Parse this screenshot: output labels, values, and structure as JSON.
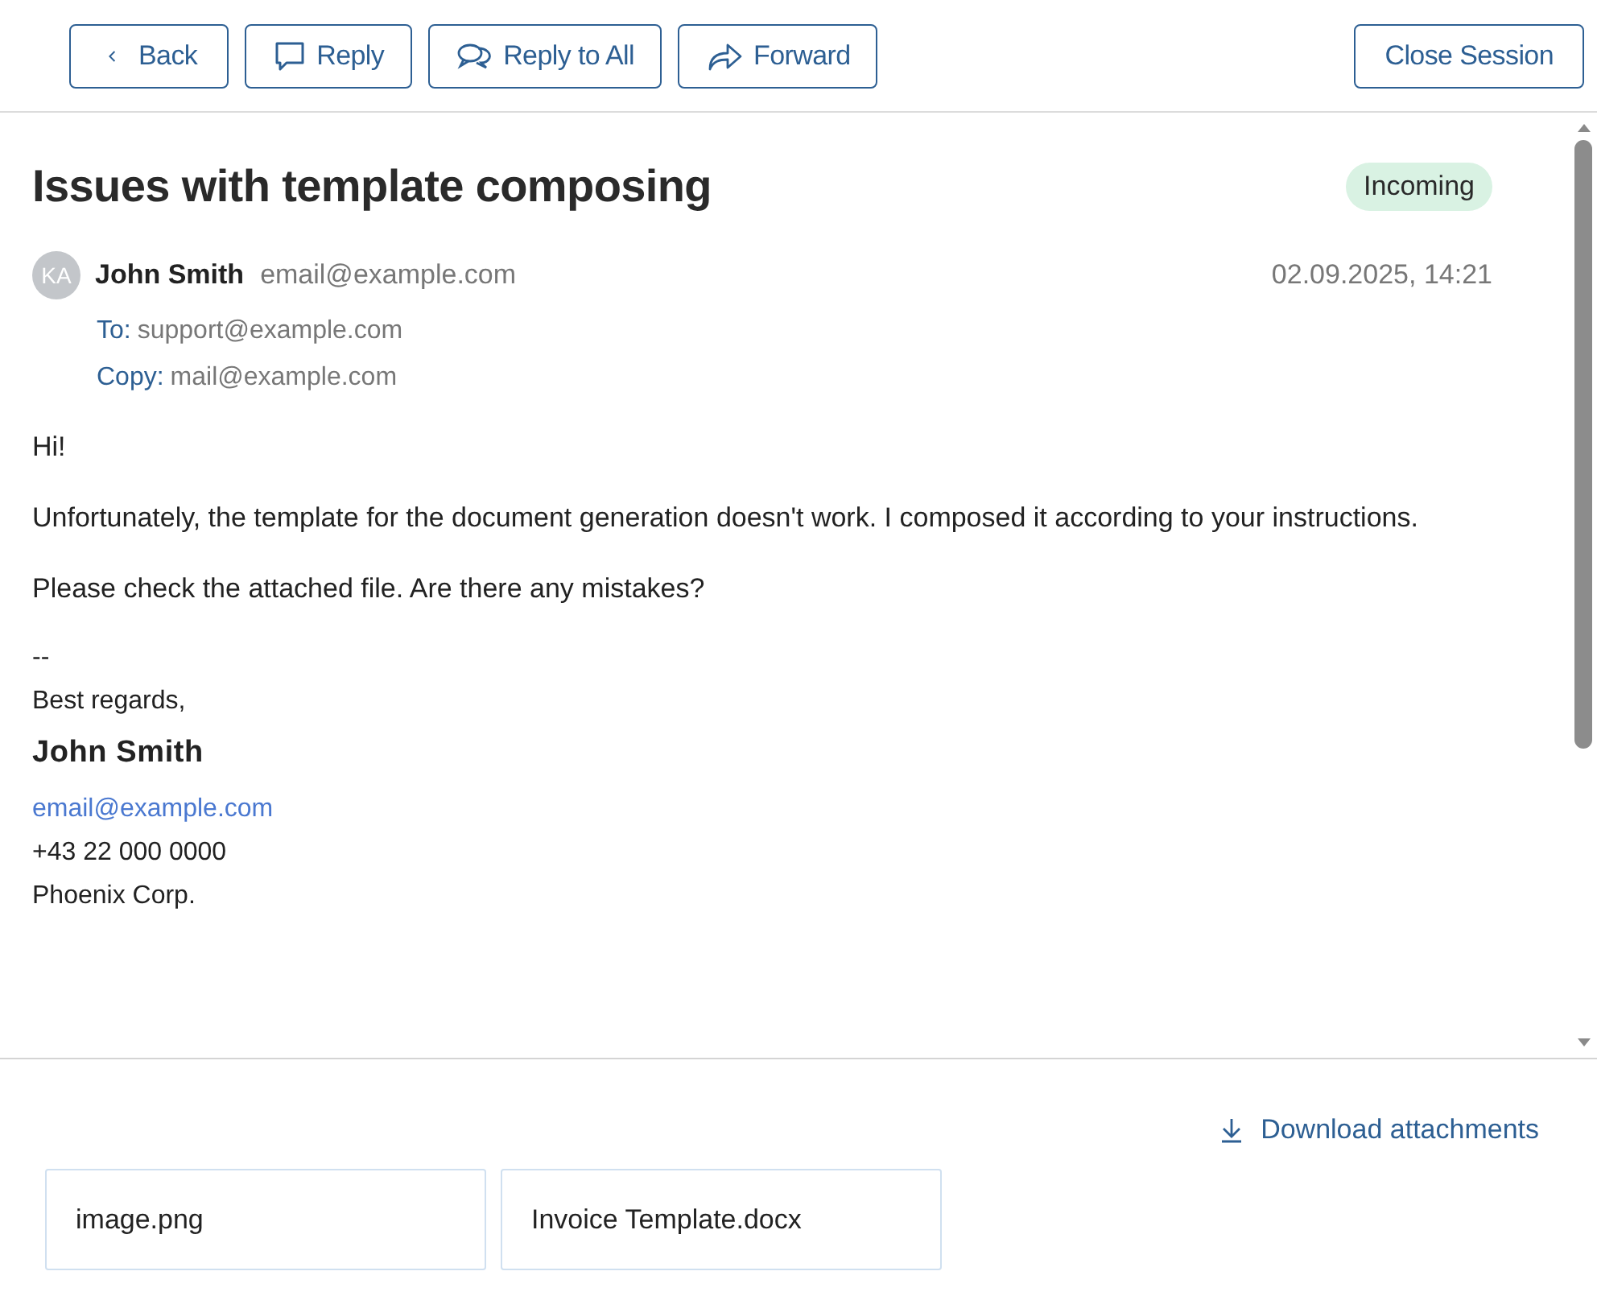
{
  "toolbar": {
    "buttons": [
      {
        "kind": "back",
        "label": "Back"
      },
      {
        "kind": "reply",
        "label": "Reply"
      },
      {
        "kind": "reply_all",
        "label": "Reply to All"
      },
      {
        "kind": "forward",
        "label": "Forward"
      }
    ],
    "close_button": "Close Session"
  },
  "message": {
    "subject": "Issues with template composing",
    "badge": "Incoming",
    "sender": {
      "initials": "KA",
      "name": "John Smith",
      "email": "email@example.com"
    },
    "date": "02.09.2025, 14:21",
    "recipients": [
      {
        "label": "To:",
        "value": "support@example.com"
      },
      {
        "label": "Copy:",
        "value": "mail@example.com"
      }
    ],
    "body": [
      "Hi!",
      "Unfortunately, the template for the document generation doesn't work. I composed it according to your instructions.",
      "Please check the attached file. Are there any mistakes?"
    ],
    "signature": {
      "separator": "--",
      "closing": "Best regards,",
      "name": "John Smith",
      "email": "email@example.com",
      "phone": "+43 22 000 0000",
      "company": "Phoenix Corp."
    }
  },
  "attachments": {
    "download": "Download attachments",
    "files": [
      "image.png",
      "Invoice Template.docx"
    ]
  }
}
